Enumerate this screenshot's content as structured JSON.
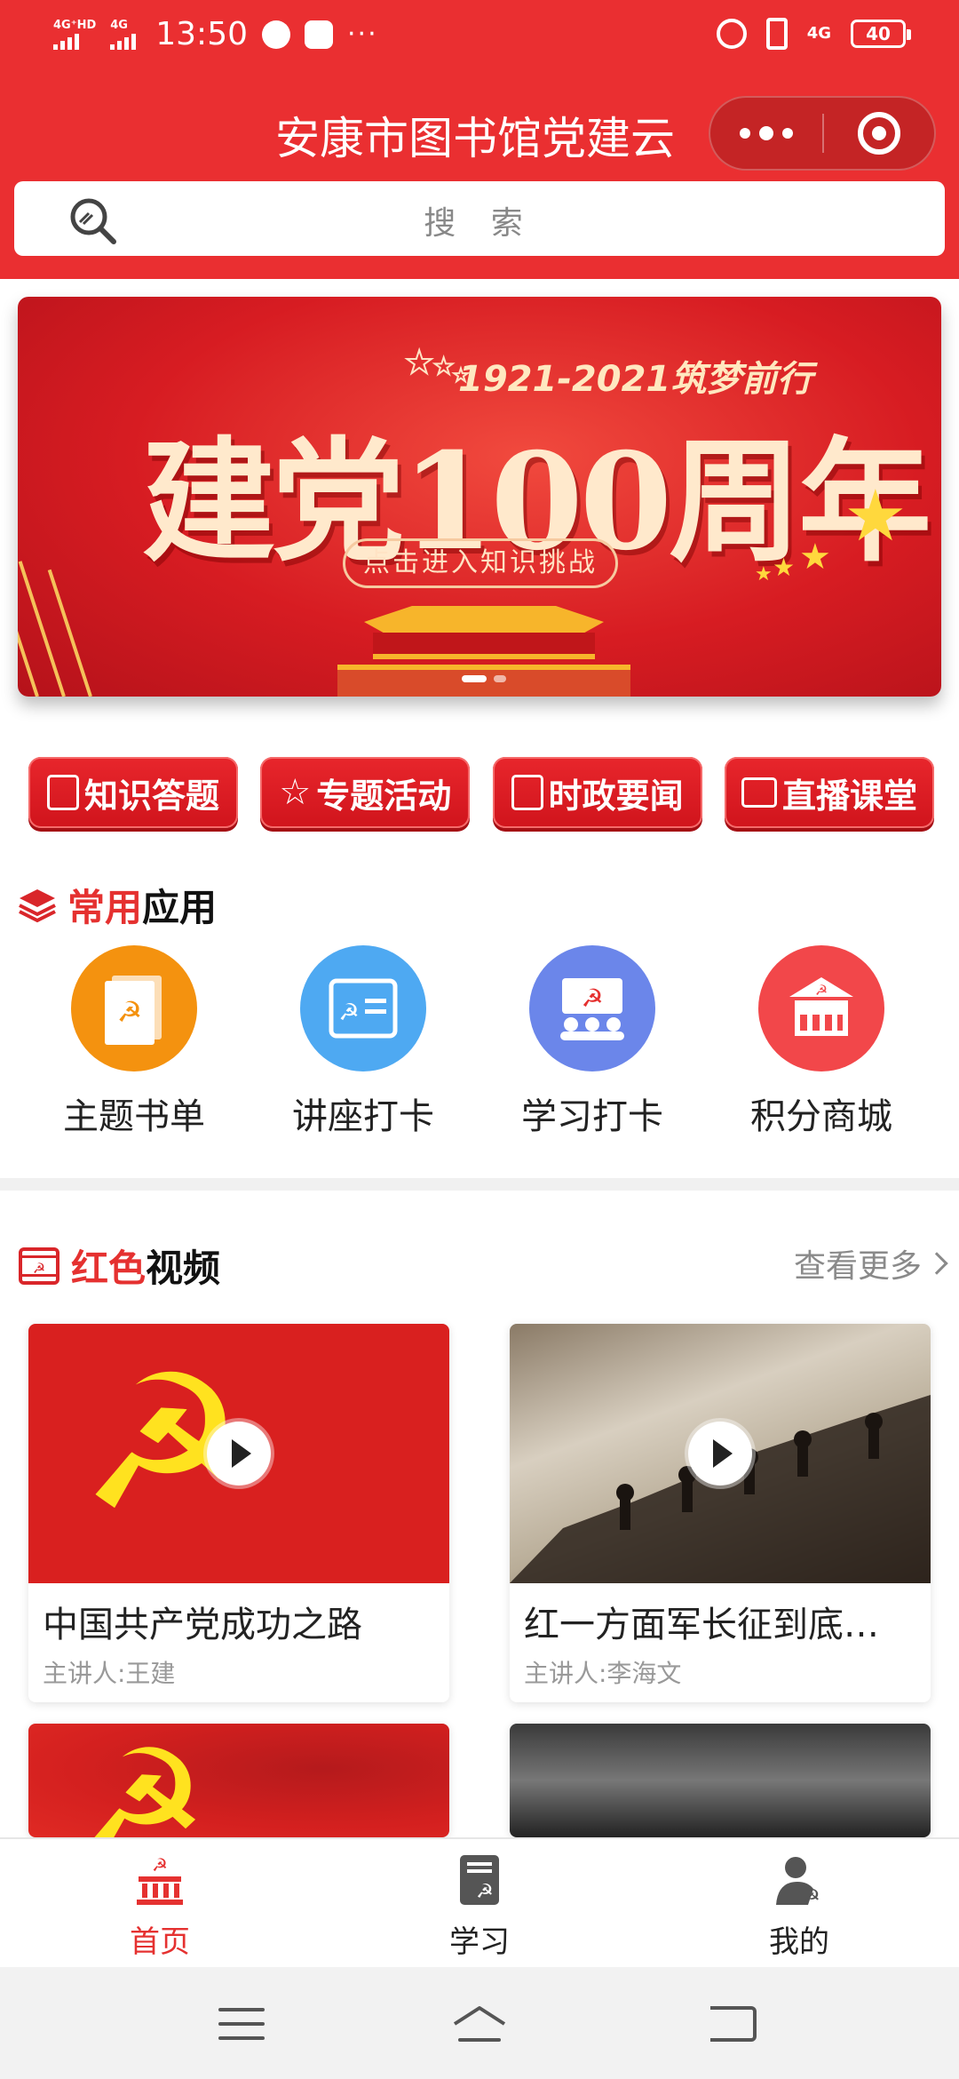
{
  "status_bar": {
    "signal1_label": "4G⁺HD",
    "signal2_label": "4G",
    "time": "13:50",
    "more": "···",
    "network": "4G",
    "battery": "40"
  },
  "header": {
    "title": "安康市图书馆党建云",
    "search_placeholder": "搜 索"
  },
  "banner": {
    "subtitle": "1921-2021筑梦前行",
    "title": "建党100周年",
    "button": "点击进入知识挑战"
  },
  "quick_buttons": [
    {
      "label": "知识答题",
      "icon": "quiz-icon"
    },
    {
      "label": "专题活动",
      "icon": "star-icon"
    },
    {
      "label": "时政要闻",
      "icon": "news-icon"
    },
    {
      "label": "直播课堂",
      "icon": "tv-icon"
    }
  ],
  "common_apps": {
    "heading_red": "常用",
    "heading_black": "应用",
    "items": [
      {
        "label": "主题书单",
        "color": "#f4920f"
      },
      {
        "label": "讲座打卡",
        "color": "#4ea9f2"
      },
      {
        "label": "学习打卡",
        "color": "#6b86ea"
      },
      {
        "label": "积分商城",
        "color": "#f2474a"
      }
    ]
  },
  "red_videos": {
    "heading_red": "红色",
    "heading_black": "视频",
    "more": "查看更多",
    "items": [
      {
        "title": "中国共产党成功之路",
        "speaker": "主讲人:王建"
      },
      {
        "title": "红一方面军长征到底…",
        "speaker": "主讲人:李海文"
      }
    ]
  },
  "tabbar": [
    {
      "label": "首页",
      "active": true
    },
    {
      "label": "学习",
      "active": false
    },
    {
      "label": "我的",
      "active": false
    }
  ],
  "colors": {
    "brand_red": "#ea2f31",
    "accent_red": "#e53130"
  }
}
